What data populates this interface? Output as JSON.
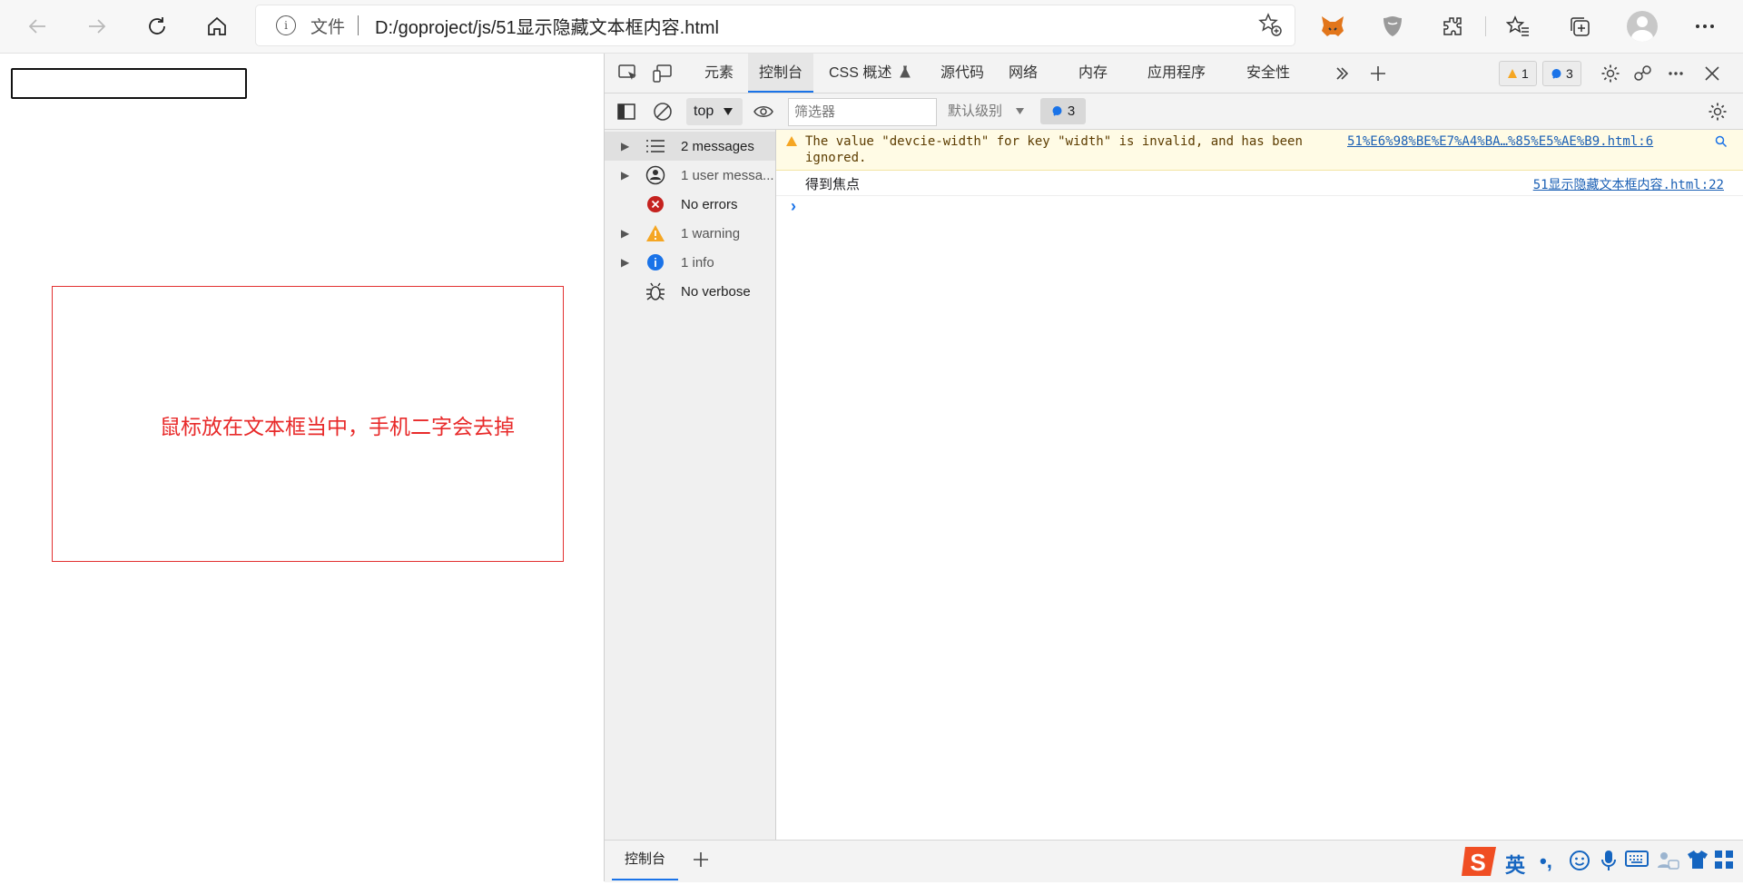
{
  "browser": {
    "address_prefix": "文件",
    "url": "D:/goproject/js/51显示隐藏文本框内容.html",
    "info_glyph": "i"
  },
  "page": {
    "red_message": "鼠标放在文本框当中，手机二字会去掉"
  },
  "devtools": {
    "tabs": [
      "元素",
      "控制台",
      "CSS 概述",
      "源代码",
      "网络",
      "内存",
      "应用程序",
      "安全性"
    ],
    "active_tab": "控制台",
    "warning_badge_count": "1",
    "info_badge_count": "3",
    "context": "top",
    "filter_placeholder": "筛选器",
    "level_label": "默认级别",
    "issues_count": "3",
    "sidebar": [
      {
        "label": "2 messages",
        "icon": "list-icon"
      },
      {
        "label": "1 user messa...",
        "icon": "user-icon"
      },
      {
        "label": "No errors",
        "icon": "error-icon"
      },
      {
        "label": "1 warning",
        "icon": "warning-icon"
      },
      {
        "label": "1 info",
        "icon": "info-icon"
      },
      {
        "label": "No verbose",
        "icon": "bug-icon"
      }
    ],
    "messages": {
      "warning_line1": "The value \"devcie-width\" for key \"width\" is invalid, and has been",
      "warning_line2": "ignored.",
      "warning_source": "51%E6%98%BE%E7%A4%BA…%85%E5%AE%B9.html:6",
      "log_text": "得到焦点",
      "log_source": "51显示隐藏文本框内容.html:22"
    },
    "drawer_tab": "控制台"
  },
  "ime": {
    "logo": "S",
    "lang": "英",
    "punct": "•,"
  }
}
